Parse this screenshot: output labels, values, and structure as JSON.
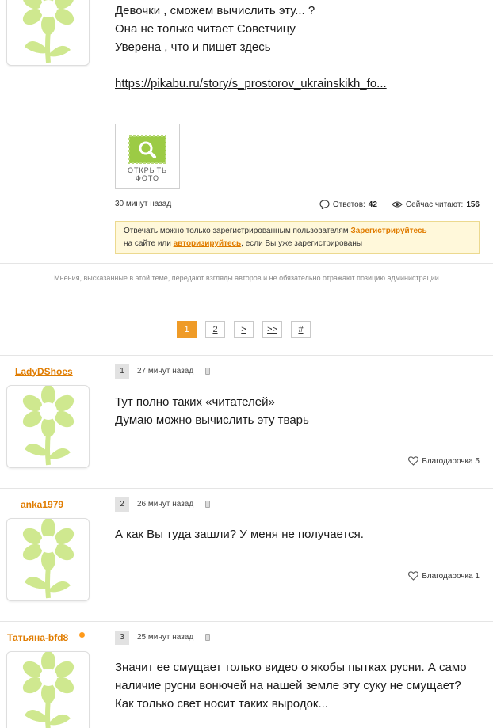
{
  "post": {
    "lines": [
      "Девочки , сможем вычислить эту... ?",
      "Она не только читает Советчицу",
      "Уверена , что и пишет здесь"
    ],
    "link": "https://pikabu.ru/story/s_prostorov_ukrainskikh_fo...",
    "photo_caption": "ОТКРЫТЬ ФОТО",
    "time": "30 минут назад",
    "replies_label": "Ответов:",
    "replies_count": "42",
    "readers_label": "Сейчас читают:",
    "readers_count": "156"
  },
  "notice": {
    "text1": "Отвечать можно только зарегистрированным пользователям ",
    "register_link": "Зарегистрируйтесь",
    "text2": "на сайте или ",
    "login_link": "авторизируйтесь",
    "text3": ", если Вы уже зарегистрированы"
  },
  "disclaimer": "Мнения, высказанные в этой теме, передают взгляды авторов и не обязательно отражают позицию администрации",
  "pagination": [
    "1",
    "2",
    ">",
    ">>",
    "#"
  ],
  "comments": [
    {
      "user": "LadyDShoes",
      "num": "1",
      "time": "27 минут назад",
      "lines": [
        "Тут полно таких «читателей»",
        "Думаю можно вычислить эту тварь"
      ],
      "thanks": "Благодарочка 5"
    },
    {
      "user": "anka1979",
      "num": "2",
      "time": "26 минут назад",
      "lines": [
        "А как Вы туда зашли? У меня не получается."
      ],
      "thanks": "Благодарочка 1"
    },
    {
      "user": "Татьяна-bfd8",
      "num": "3",
      "time": "25 минут назад",
      "lines": [
        "Значит ее смущает только видео о якобы пытках русни. А само",
        "наличие русни вонючей на нашей земле эту суку не смущает?",
        "Как только свет носит таких выродок..."
      ]
    }
  ],
  "colors": {
    "accent": "#e07c00",
    "page_active": "#ef9b27",
    "flower": "#c9e58a",
    "notice_bg": "#fff8da"
  }
}
